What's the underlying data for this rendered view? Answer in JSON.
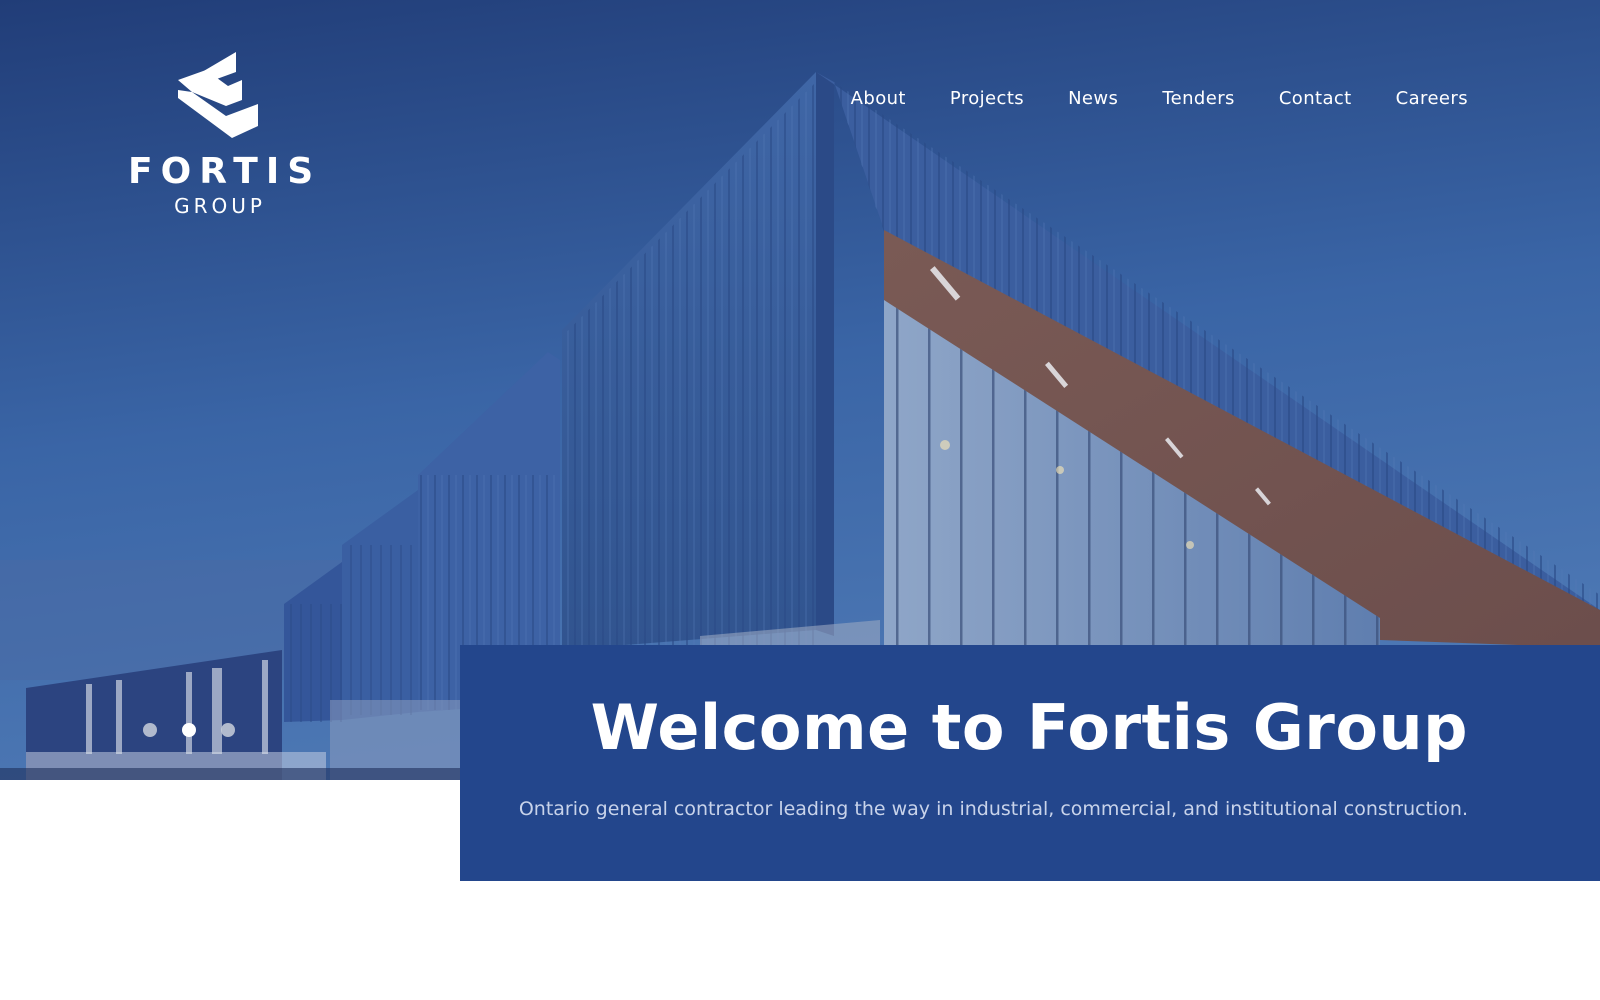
{
  "brand": {
    "name": "FORTIS",
    "subtitle": "GROUP"
  },
  "nav": {
    "items": [
      {
        "label": "About"
      },
      {
        "label": "Projects"
      },
      {
        "label": "News"
      },
      {
        "label": "Tenders"
      },
      {
        "label": "Contact"
      },
      {
        "label": "Careers"
      }
    ]
  },
  "hero": {
    "title": "Welcome to Fortis Group",
    "subtitle": "Ontario general contractor leading the way in industrial, commercial, and institutional construction.",
    "slides": {
      "count": 3,
      "active_index": 1
    }
  },
  "colors": {
    "accent_blue": "#23468c",
    "sky_top": "#1f3c78",
    "text_white": "#ffffff"
  },
  "icons": {
    "logo": "fortis-logo-icon"
  }
}
